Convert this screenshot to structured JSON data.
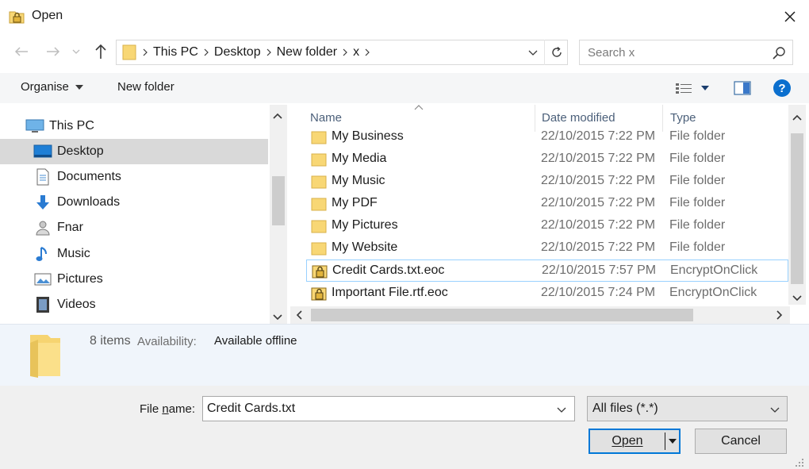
{
  "window": {
    "title": "Open",
    "close_glyph": "✕"
  },
  "address": {
    "crumbs": [
      "This PC",
      "Desktop",
      "New folder",
      "x"
    ],
    "search_placeholder": "Search x"
  },
  "toolbar": {
    "organise_label": "Organise",
    "new_folder_label": "New folder",
    "help_glyph": "?"
  },
  "nav": {
    "items": [
      {
        "label": "This PC",
        "icon": "computer-icon"
      },
      {
        "label": "Desktop",
        "icon": "desktop-icon",
        "selected": true
      },
      {
        "label": "Documents",
        "icon": "documents-icon"
      },
      {
        "label": "Downloads",
        "icon": "downloads-icon"
      },
      {
        "label": "Fnar",
        "icon": "user-icon"
      },
      {
        "label": "Music",
        "icon": "music-icon"
      },
      {
        "label": "Pictures",
        "icon": "pictures-icon"
      },
      {
        "label": "Videos",
        "icon": "videos-icon"
      }
    ]
  },
  "filelist": {
    "columns": {
      "name": "Name",
      "date": "Date modified",
      "type": "Type"
    },
    "rows": [
      {
        "name": "My Business",
        "date": "22/10/2015 7:22 PM",
        "type": "File folder",
        "icon": "folder-icon"
      },
      {
        "name": "My Media",
        "date": "22/10/2015 7:22 PM",
        "type": "File folder",
        "icon": "folder-icon"
      },
      {
        "name": "My Music",
        "date": "22/10/2015 7:22 PM",
        "type": "File folder",
        "icon": "folder-icon"
      },
      {
        "name": "My PDF",
        "date": "22/10/2015 7:22 PM",
        "type": "File folder",
        "icon": "folder-icon"
      },
      {
        "name": "My Pictures",
        "date": "22/10/2015 7:22 PM",
        "type": "File folder",
        "icon": "folder-icon"
      },
      {
        "name": "My Website",
        "date": "22/10/2015 7:22 PM",
        "type": "File folder",
        "icon": "folder-icon"
      },
      {
        "name": "Credit Cards.txt.eoc",
        "date": "22/10/2015 7:57 PM",
        "type": "EncryptOnClick",
        "icon": "encrypted-file-icon",
        "selected": true
      },
      {
        "name": "Important File.rtf.eoc",
        "date": "22/10/2015 7:24 PM",
        "type": "EncryptOnClick",
        "icon": "encrypted-file-icon"
      }
    ]
  },
  "details": {
    "count": "8 items",
    "availability_label": "Availability:",
    "availability_value": "Available offline"
  },
  "footer": {
    "filename_label_prefix": "File ",
    "filename_label_accel": "n",
    "filename_label_suffix": "ame:",
    "filename_value": "Credit Cards.txt",
    "filter_value": "All files (*.*)",
    "open_label": "Open",
    "cancel_label": "Cancel"
  },
  "colors": {
    "accent": "#0078d7",
    "folder": "#f8d775",
    "selection": "#d9d9d9",
    "column_header": "#4c607a"
  }
}
